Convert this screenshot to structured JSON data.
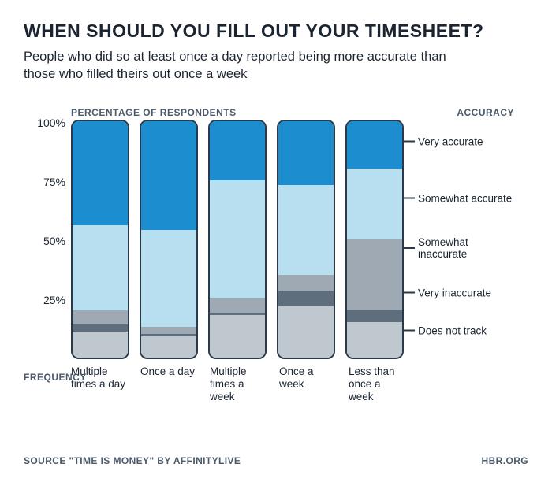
{
  "title": "WHEN SHOULD YOU FILL OUT YOUR TIMESHEET?",
  "subtitle": "People who did so at least once a day reported being more accurate than those who filled theirs out once a week",
  "y_label": "Percentage of Respondents",
  "legend_label": "Accuracy",
  "x_label": "Frequency",
  "y_ticks": [
    "100%",
    "75%",
    "50%",
    "25%"
  ],
  "categories": [
    "Multiple times a day",
    "Once a day",
    "Multiple times a week",
    "Once a week",
    "Less than once a week"
  ],
  "legend": [
    "Very accurate",
    "Somewhat accurate",
    "Somewhat inaccurate",
    "Very inaccurate",
    "Does not track"
  ],
  "legend_pos": [
    8,
    32,
    53,
    72,
    88
  ],
  "source_label": "SOURCE",
  "source_text": "\"TIME IS MONEY\"  BY AFFINITYLIVE",
  "site": "HBR.ORG",
  "chart_data": {
    "type": "bar",
    "stacked": true,
    "ylabel": "Percentage of respondents",
    "ylim": [
      0,
      100
    ],
    "categories": [
      "Multiple times a day",
      "Once a day",
      "Multiple times a week",
      "Once a week",
      "Less than once a week"
    ],
    "series": [
      {
        "name": "Very accurate",
        "color": "#1c8ecf",
        "values": [
          44,
          46,
          25,
          27,
          20
        ]
      },
      {
        "name": "Somewhat accurate",
        "color": "#b8dff0",
        "values": [
          36,
          41,
          50,
          38,
          30
        ]
      },
      {
        "name": "Somewhat inaccurate",
        "color": "#9ea9b3",
        "values": [
          6,
          3,
          6,
          7,
          30
        ]
      },
      {
        "name": "Very inaccurate",
        "color": "#5e6e7c",
        "values": [
          3,
          1,
          1,
          6,
          5
        ]
      },
      {
        "name": "Does not track",
        "color": "#c0c8cf",
        "values": [
          11,
          9,
          18,
          22,
          15
        ]
      }
    ]
  }
}
